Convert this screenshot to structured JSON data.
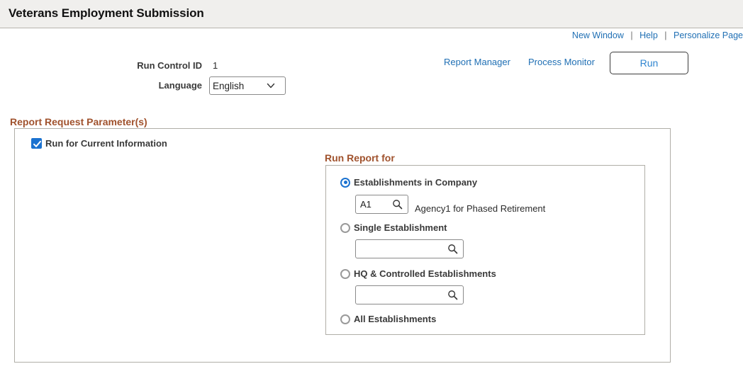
{
  "header": {
    "title": "Veterans Employment Submission"
  },
  "util_links": {
    "new_window": "New Window",
    "help": "Help",
    "personalize_page": "Personalize Page",
    "separator": "|"
  },
  "run_control": {
    "id_label": "Run Control ID",
    "id_value": "1",
    "language_label": "Language",
    "language_value": "English",
    "language_options": [
      "English"
    ]
  },
  "process_actions": {
    "report_manager": "Report Manager",
    "process_monitor": "Process Monitor",
    "run_button": "Run"
  },
  "report_request": {
    "section_heading": "Report Request Parameter(s)",
    "run_current_info_label": "Run for Current Information",
    "run_current_info_checked": true
  },
  "run_report_for": {
    "group_heading": "Run Report for",
    "options": [
      {
        "label": "Establishments in Company",
        "selected": true,
        "prompt_value": "A1",
        "description": "Agency1 for Phased Retirement",
        "icon": "search-icon"
      },
      {
        "label": "Single Establishment",
        "selected": false,
        "prompt_value": "",
        "description": "",
        "icon": "search-icon"
      },
      {
        "label": "HQ & Controlled Establishments",
        "selected": false,
        "prompt_value": "",
        "description": "",
        "icon": "search-icon"
      },
      {
        "label": "All Establishments",
        "selected": false
      }
    ]
  },
  "colors": {
    "header_bg": "#f0efed",
    "link_blue": "#1f6fb4",
    "heading_brown": "#a0522d",
    "accent_blue": "#1b72d0",
    "panel_border": "#b0aea7"
  }
}
